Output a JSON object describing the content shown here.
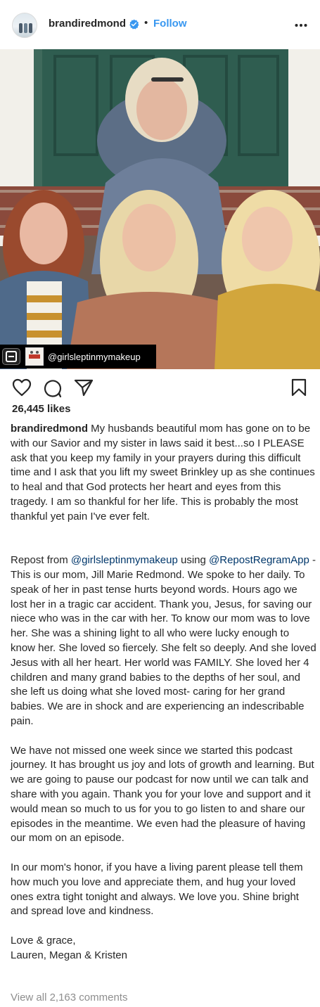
{
  "header": {
    "username": "brandiredmond",
    "separator": "•",
    "follow_label": "Follow"
  },
  "photo": {
    "repost_handle": "@girlsleptinmymakeup"
  },
  "actions": {
    "likes": "26,445 likes"
  },
  "caption": {
    "author": "brandiredmond",
    "p1_text": " My husbands beautiful mom has gone on to be with our Savior and my sister in laws said it best...so I PLEASE ask that you keep my family in your prayers during this difficult time and I ask that you lift my sweet Brinkley up as she continues to heal and that God protects her heart and eyes from this tragedy. I am so thankful for her life. This is probably the most thankful yet pain I've ever felt.",
    "p2_prefix": "Repost from ",
    "p2_mention1": "@girlsleptinmymakeup",
    "p2_mid": " using ",
    "p2_mention2": "@RepostRegramApp",
    "p2_text": " - This is our mom, Jill Marie Redmond. We spoke to her daily. To speak of her in past tense hurts beyond words. Hours ago we lost her in a tragic car accident. Thank you, Jesus, for saving our niece who was in the car with her. To know our mom was to love her. She was a shining light to all who were lucky enough to know her. She loved so fiercely. She felt so deeply. And she loved Jesus with all her heart. Her world was FAMILY. She loved her 4 children and many grand babies to the depths of her soul, and she left us doing what she loved most- caring for her grand babies. We are in shock and are experiencing an indescribable pain.",
    "p3_text": "We have not missed one week since we started this podcast journey. It has brought us joy and lots of growth and learning. But we are going to pause our podcast for now until we can talk and share with you again. Thank you for your love and support and it would mean so much to us for you to go listen to and share our episodes in the meantime. We even had the pleasure of having our mom on an episode.",
    "p4_text": "In our mom's honor, if you have a living parent please tell them how much you love and appreciate them, and hug your loved ones extra tight tonight and always. We love you. Shine bright and spread love and kindness.",
    "signoff_line1": "Love & grace,",
    "signoff_line2": "Lauren, Megan & Kristen"
  },
  "comments": {
    "view_all": "View all 2,163 comments"
  },
  "colors": {
    "link_blue": "#3897f0",
    "mention_blue": "#00376b",
    "muted_gray": "#8e8e8e",
    "text": "#262626"
  },
  "icons": [
    "verified-badge-icon",
    "more-options-icon",
    "heart-icon",
    "comment-icon",
    "share-icon",
    "bookmark-icon",
    "repost-app-icon"
  ]
}
